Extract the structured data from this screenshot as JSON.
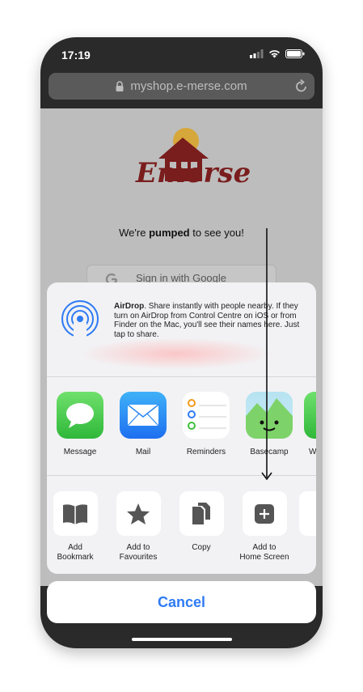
{
  "status": {
    "time": "17:19"
  },
  "browser": {
    "url": "myshop.e-merse.com"
  },
  "page": {
    "logo_text": "Emerse",
    "tagline_pre": "We're ",
    "tagline_bold": "pumped",
    "tagline_post": " to see you!",
    "google_button": "Sign in with Google"
  },
  "share_sheet": {
    "airdrop": {
      "title": "AirDrop",
      "description": ". Share instantly with people nearby. If they turn on AirDrop from Control Centre on iOS or from Finder on the Mac, you'll see their names here. Just tap to share."
    },
    "apps": [
      {
        "label": "Message",
        "icon": "messages-icon"
      },
      {
        "label": "Mail",
        "icon": "mail-icon"
      },
      {
        "label": "Reminders",
        "icon": "reminders-icon"
      },
      {
        "label": "Basecamp",
        "icon": "basecamp-icon"
      },
      {
        "label": "W",
        "icon": "partial-app-icon"
      }
    ],
    "actions": [
      {
        "label": "Add\nBookmark",
        "icon": "book-icon"
      },
      {
        "label": "Add to\nFavourites",
        "icon": "star-icon"
      },
      {
        "label": "Copy",
        "icon": "copy-icon"
      },
      {
        "label": "Add to\nHome Screen",
        "icon": "plus-square-icon"
      }
    ],
    "cancel_label": "Cancel"
  },
  "colors": {
    "accent": "#2f7bf5",
    "brand": "#7a1d1d"
  }
}
